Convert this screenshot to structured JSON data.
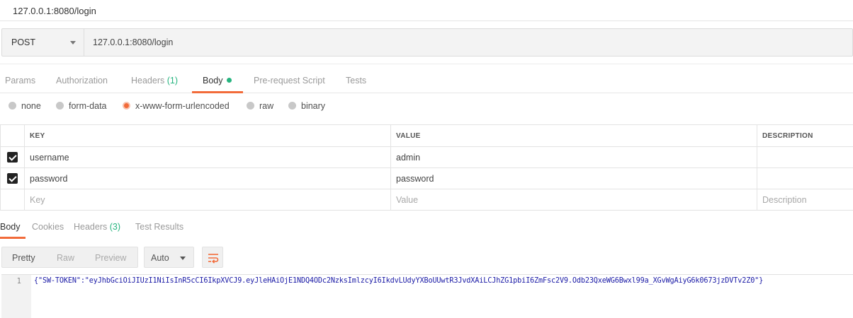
{
  "window": {
    "title": "127.0.0.1:8080/login"
  },
  "request": {
    "method": "POST",
    "url": "127.0.0.1:8080/login"
  },
  "request_tabs": {
    "params": "Params",
    "authorization": "Authorization",
    "headers_label": "Headers",
    "headers_count": "(1)",
    "body": "Body",
    "pre_request": "Pre-request Script",
    "tests": "Tests"
  },
  "body_modes": {
    "none": "none",
    "form_data": "form-data",
    "urlencoded": "x-www-form-urlencoded",
    "raw": "raw",
    "binary": "binary",
    "selected": "x-www-form-urlencoded"
  },
  "params_table": {
    "headers": {
      "key": "KEY",
      "value": "VALUE",
      "description": "DESCRIPTION"
    },
    "rows": [
      {
        "key": "username",
        "value": "admin",
        "description": "",
        "checked": true
      },
      {
        "key": "password",
        "value": "password",
        "description": "",
        "checked": true
      }
    ],
    "placeholder": {
      "key": "Key",
      "value": "Value",
      "description": "Description"
    }
  },
  "response_tabs": {
    "body": "Body",
    "cookies": "Cookies",
    "headers_label": "Headers",
    "headers_count": "(3)",
    "test_results": "Test Results"
  },
  "viewer": {
    "pretty": "Pretty",
    "raw": "Raw",
    "preview": "Preview",
    "format": "Auto"
  },
  "response_body": {
    "line_number": "1",
    "text": "{\"SW-TOKEN\":\"eyJhbGciOiJIUzI1NiIsInR5cCI6IkpXVCJ9.eyJleHAiOjE1NDQ4ODc2NzksImlzcyI6IkdvLUdyYXBoUUwtR3JvdXAiLCJhZG1pbiI6ZmFsc2V9.Odb23QxeWG6Bwxl99a_XGvWgAiyG6k0673jzDVTv2Z0\"}"
  },
  "colors": {
    "accent": "#f26b3a",
    "green": "#26b47f"
  }
}
